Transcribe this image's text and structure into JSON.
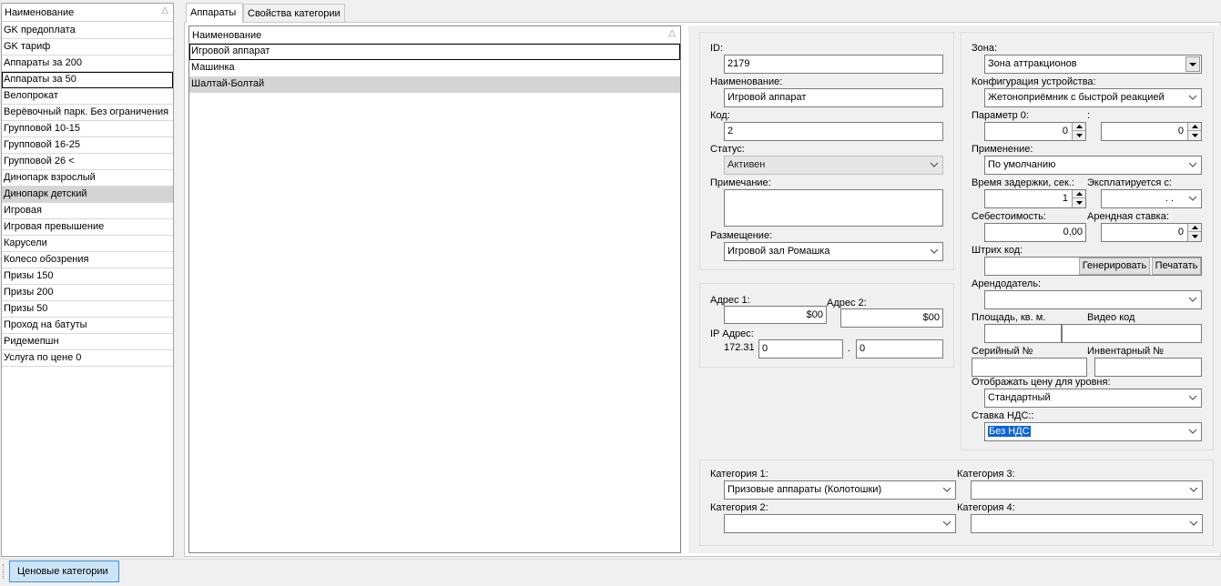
{
  "left_list": {
    "header": "Наименование",
    "items": [
      "GK  предоплата",
      "GK тариф",
      "Аппараты за 200",
      "Аппараты за 50",
      "Велопрокат",
      "Верёвочный парк. Без ограничения",
      "Групповой 10-15",
      "Групповой 16-25",
      "Групповой 26 <",
      "Динопарк взрослый",
      "Динопарк детский",
      "Игровая",
      "Игровая превышение",
      "Карусели",
      "Колесо обозрения",
      "Призы 150",
      "Призы 200",
      "Призы 50",
      "Проход на батуты",
      "Ридемепшн",
      "Услуга по цене 0"
    ],
    "selected": "Динопарк детский",
    "focused": "Аппараты за 50"
  },
  "tabs": [
    "Аппараты",
    "Свойства категории"
  ],
  "device_list": {
    "header": "Наименование",
    "items": [
      "Игровой аппарат",
      "Машинка",
      "Шалтай-Болтай"
    ],
    "focused": "Игровой аппарат",
    "selected": "Шалтай-Болтай"
  },
  "form": {
    "id_label": "ID:",
    "id_value": "2179",
    "name_label": "Наименование:",
    "name_value": "Игровой аппарат",
    "code_label": "Код:",
    "code_value": "2",
    "status_label": "Статус:",
    "status_value": "Активен",
    "note_label": "Примечание:",
    "placement_label": "Размещение:",
    "placement_value": "Игровой зал Ромашка",
    "addr1_label": "Адрес 1:",
    "addr1_value": "$00",
    "addr2_label": "Адрес 2:",
    "addr2_value": "$00",
    "ip_label": "IP Адрес:",
    "ip_prefix": "172.31",
    "ip_part1": "0",
    "ip_dot": ".",
    "ip_part2": "0",
    "zone_label": "Зона:",
    "zone_value": "Зона аттракционов",
    "config_label": "Конфигурация устройства:",
    "config_value": "Жетоноприёмник с быстрой реакцией",
    "param_label": "Параметр 0:",
    "param_colon": ":",
    "param_value1": "0",
    "param_value2": "0",
    "usage_label": "Применение:",
    "usage_value": "По умолчанию",
    "delay_label": "Время задержки, сек.:",
    "delay_value": "1",
    "operated_label": "Эксплатируется с:",
    "operated_value": ".  .",
    "cost_label": "Себестоимость:",
    "cost_value": "0,00",
    "rent_label": "Арендная ставка:",
    "rent_value": "0",
    "barcode_label": "Штрих код:",
    "generate_btn": "Генерировать",
    "print_btn": "Печатать",
    "landlord_label": "Арендодатель:",
    "area_label": "Площадь, кв. м.",
    "video_label": "Видео код",
    "serial_label": "Серийный №",
    "inventory_label": "Инвентарный №",
    "price_level_label": "Отображать цену для уровня:",
    "price_level_value": "Стандартный",
    "vat_label": "Ставка НДС::",
    "vat_value": "Без НДС",
    "cat1_label": "Категория 1:",
    "cat1_value": "Призовые аппараты (Колотошки)",
    "cat2_label": "Категория 2:",
    "cat3_label": "Категория 3:",
    "cat4_label": "Категория 4:"
  },
  "bottom": {
    "price_categories_btn": "Ценовые категории"
  },
  "icons": {
    "sort": "sort-triangle-icon",
    "dropdown": "chevron-down-icon",
    "spin_up": "spin-up-icon",
    "spin_down": "spin-down-icon"
  }
}
